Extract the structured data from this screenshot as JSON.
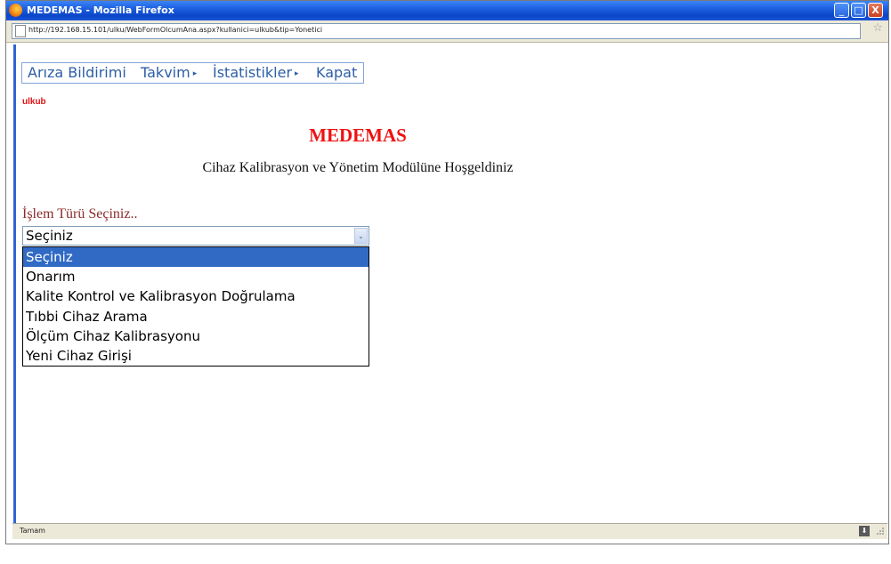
{
  "window": {
    "title": "MEDEMAS - Mozilla Firefox",
    "minimize_glyph": "_",
    "maximize_glyph": "□",
    "close_glyph": "X"
  },
  "address_bar": {
    "url": "http://192.168.15.101/ulku/WebFormOlcumAna.aspx?kullanici=ulkub&tip=Yonetici",
    "bookmark_icon": "☆"
  },
  "menu": {
    "items": [
      {
        "label": "Arıza Bildirimi",
        "has_submenu": false
      },
      {
        "label": "Takvim",
        "has_submenu": true
      },
      {
        "label": "İstatistikler",
        "has_submenu": true
      },
      {
        "label": "Kapat",
        "has_submenu": false
      }
    ],
    "arrow_glyph": "▸"
  },
  "page": {
    "username": "ulkub",
    "heading": "MEDEMAS",
    "welcome": "Cihaz Kalibrasyon ve Yönetim Modülüne Hoşgeldiniz",
    "select_label": "İşlem Türü Seçiniz..",
    "select_value": "Seçiniz",
    "select_arrow": "⌄",
    "options": [
      "Seçiniz",
      "Onarım",
      "Kalite Kontrol ve Kalibrasyon Doğrulama",
      "Tıbbi Cihaz Arama",
      "Ölçüm Cihaz Kalibrasyonu",
      "Yeni Cihaz Girişi"
    ],
    "highlighted_option": "Seçiniz"
  },
  "status_bar": {
    "text": "Tamam",
    "download_glyph": "⬇"
  },
  "colors": {
    "title_bar": "#1d5fe0",
    "heading": "#ee1111",
    "username": "#e11414",
    "menu_text": "#2d5ea8",
    "label": "#8b2b2b",
    "selection": "#316ac5"
  }
}
